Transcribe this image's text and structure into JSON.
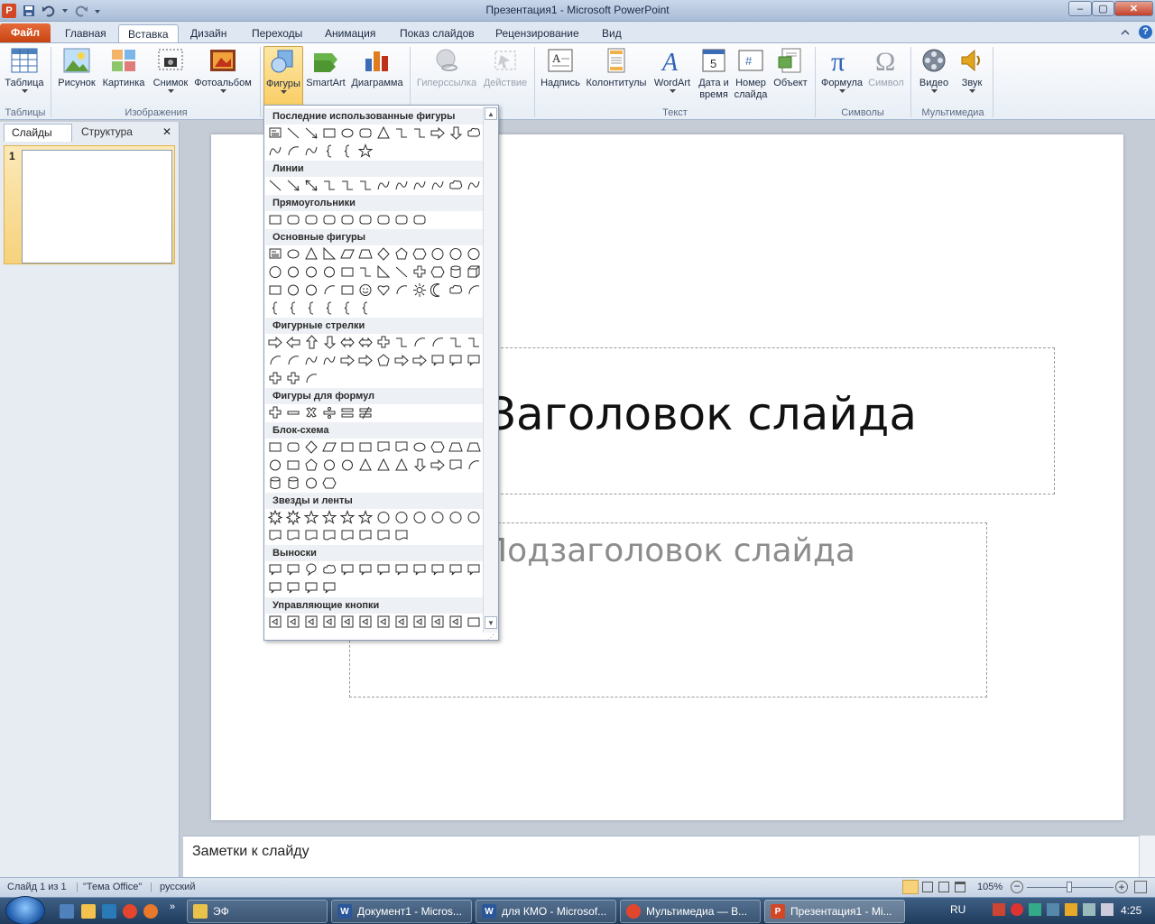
{
  "window": {
    "title": "Презентация1 - Microsoft PowerPoint",
    "app_icon": "P",
    "min_label": "–",
    "max_label": "▢",
    "close_label": "✕"
  },
  "tabs": {
    "file": "Файл",
    "items": [
      "Главная",
      "Вставка",
      "Дизайн",
      "Переходы",
      "Анимация",
      "Показ слайдов",
      "Рецензирование",
      "Вид"
    ],
    "active": "Вставка"
  },
  "ribbon": {
    "buttons": {
      "table": "Таблица",
      "picture": "Рисунок",
      "clipart": "Картинка",
      "screenshot": "Снимок",
      "photoalbum": "Фотоальбом",
      "shapes": "Фигуры",
      "smartart": "SmartArt",
      "chart": "Диаграмма",
      "hyperlink": "Гиперссылка",
      "action": "Действие",
      "textbox": "Надпись",
      "headerfooter": "Колонтитулы",
      "wordart": "WordArt",
      "datetime_1": "Дата и",
      "datetime_2": "время",
      "slidenum_1": "Номер",
      "slidenum_2": "слайда",
      "object": "Объект",
      "equation": "Формула",
      "symbol": "Символ",
      "video": "Видео",
      "audio": "Звук"
    },
    "groups": {
      "tables": "Таблицы",
      "images": "Изображения",
      "text": "Текст",
      "symbols": "Символы",
      "media": "Мультимедиа"
    }
  },
  "left_pane": {
    "tab_slides": "Слайды",
    "tab_outline": "Структура",
    "close_label": "✕",
    "slide_number": "1"
  },
  "slide": {
    "title_placeholder": "Заголовок слайда",
    "subtitle_placeholder": "Подзаголовок слайда"
  },
  "shapes_menu": {
    "sections": {
      "recent": "Последние использованные фигуры",
      "lines": "Линии",
      "rectangles": "Прямоугольники",
      "basic": "Основные фигуры",
      "arrows": "Фигурные стрелки",
      "equation": "Фигуры для формул",
      "flowchart": "Блок-схема",
      "stars": "Звезды и ленты",
      "callouts": "Выноски",
      "action_buttons": "Управляющие кнопки"
    }
  },
  "notes": {
    "placeholder": "Заметки к слайду"
  },
  "status": {
    "slide_info": "Слайд 1 из 1",
    "theme": "\"Тема Office\"",
    "language": "русский",
    "zoom": "105%"
  },
  "taskbar": {
    "items": [
      "ЭФ",
      "Документ1 - Micros...",
      "для КМО - Microsof...",
      "Мультимедиа — В...",
      "Презентация1 - Mi..."
    ],
    "lang": "RU",
    "time": "4:25"
  },
  "colors": {
    "accent": "#2b579a",
    "file_tab": "#d24726",
    "selected": "#f8c95a"
  }
}
